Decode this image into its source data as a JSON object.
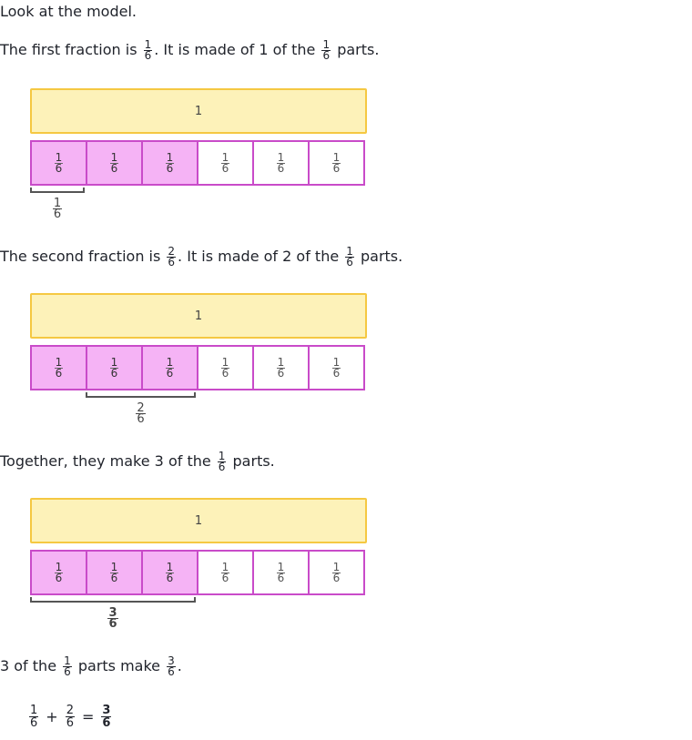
{
  "intro": "Look at the model.",
  "unit_label": "1",
  "part_fraction": {
    "num": "1",
    "den": "6"
  },
  "sentence1": {
    "a": "The first fraction is ",
    "frac": {
      "num": "1",
      "den": "6"
    },
    "b": ". It is made of 1 of the ",
    "c": " parts."
  },
  "sentence2": {
    "a": "The second fraction is ",
    "frac": {
      "num": "2",
      "den": "6"
    },
    "b": ". It is made of 2 of the ",
    "c": " parts."
  },
  "sentence3": {
    "a": "Together, they make 3 of the ",
    "c": " parts."
  },
  "sentence4": {
    "a": "3 of the ",
    "b": " parts make ",
    "frac": {
      "num": "3",
      "den": "6"
    },
    "c": "."
  },
  "models": [
    {
      "shaded": [
        true,
        true,
        true,
        false,
        false,
        false
      ],
      "bracket_label": {
        "num": "1",
        "den": "6"
      }
    },
    {
      "shaded": [
        true,
        true,
        true,
        false,
        false,
        false
      ],
      "bracket_label": {
        "num": "2",
        "den": "6"
      }
    },
    {
      "shaded": [
        true,
        true,
        true,
        false,
        false,
        false
      ],
      "bracket_label": {
        "num": "3",
        "den": "6"
      }
    }
  ],
  "equation": {
    "a": {
      "num": "1",
      "den": "6"
    },
    "plus": "+",
    "b": {
      "num": "2",
      "den": "6"
    },
    "equals": "=",
    "result": {
      "num": "3",
      "den": "6"
    }
  },
  "colors": {
    "whole_fill": "#fdf2b9",
    "whole_border": "#f5c842",
    "part_shaded": "#f5b3f5",
    "part_border": "#c94bc9"
  }
}
